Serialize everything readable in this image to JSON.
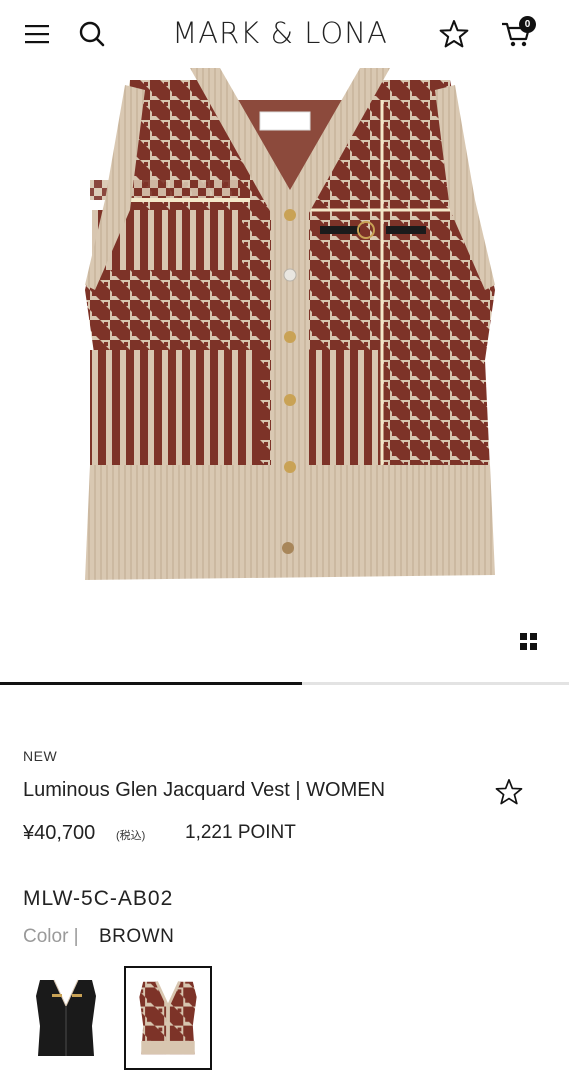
{
  "header": {
    "logo": "MARK & LONA",
    "cart_count": "0",
    "icons": [
      "hamburger-menu-icon",
      "search-icon",
      "star-icon",
      "cart-icon"
    ]
  },
  "gallery": {
    "progress_fraction": 0.53,
    "product_image": "knit-vest-image"
  },
  "product": {
    "badge": "NEW",
    "title": "Luminous Glen Jacquard Vest | WOMEN",
    "price": "¥40,700",
    "tax_note": "(税込)",
    "points": "1,221 POINT",
    "sku": "MLW-5C-AB02",
    "color_label": "Color |",
    "color_value": "BROWN"
  },
  "colors": {
    "vest_base": "#d8c6b0",
    "vest_pattern": "#7d3328",
    "black_vest": "#1a1a1a",
    "accent": "#111111"
  }
}
